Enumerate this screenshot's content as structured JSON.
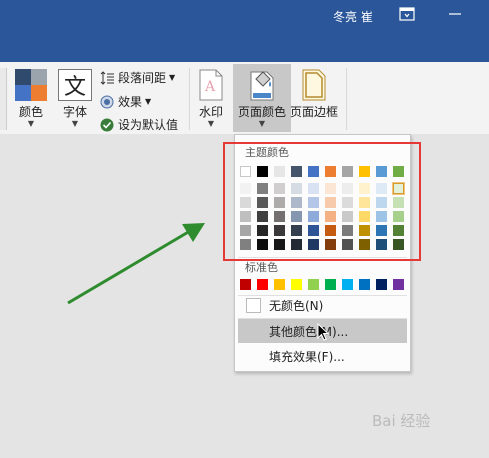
{
  "titlebar": {
    "user": "冬亮 崔",
    "ribbon_display_icon": "ribbon-display-options-icon",
    "minimize_icon": "minimize-icon",
    "bg": "#2b579a"
  },
  "ribbon": {
    "color_label": "颜色",
    "font_label": "字体",
    "font_glyph": "文",
    "paragraph_spacing": "段落间距",
    "effects": "效果",
    "set_default": "设为默认值",
    "watermark_label": "水印",
    "page_color_label": "页面颜色",
    "page_border_label": "页面边框"
  },
  "dropdown": {
    "theme_title": "主题颜色",
    "standard_title": "标准色",
    "no_color": "无颜色(N)",
    "more_colors": "其他颜色(M)...",
    "fill_effects": "填充效果(F)...",
    "theme_colors": [
      [
        "#ffffff",
        "#f2f2f2",
        "#d9d9d9",
        "#bfbfbf",
        "#a6a6a6",
        "#808080"
      ],
      [
        "#000000",
        "#7f7f7f",
        "#595959",
        "#3f3f3f",
        "#262626",
        "#0d0d0d"
      ],
      [
        "#e7e6e6",
        "#d0cece",
        "#aeabab",
        "#757070",
        "#3a3838",
        "#171616"
      ],
      [
        "#44546a",
        "#d6dce4",
        "#adb9ca",
        "#8496b0",
        "#333f4f",
        "#222a35"
      ],
      [
        "#4472c4",
        "#d9e2f3",
        "#b4c6e7",
        "#8eaadb",
        "#2f5496",
        "#1f3864"
      ],
      [
        "#ed7d31",
        "#fbe5d5",
        "#f7caac",
        "#f4b183",
        "#c55a11",
        "#833c0b"
      ],
      [
        "#a5a5a5",
        "#ededed",
        "#dbdbdb",
        "#c9c9c9",
        "#7b7b7b",
        "#525252"
      ],
      [
        "#ffc000",
        "#fff2cc",
        "#fee599",
        "#ffd965",
        "#bf9000",
        "#7f6000"
      ],
      [
        "#5b9bd5",
        "#deebf6",
        "#bdd7ee",
        "#9dc3e6",
        "#2e75b5",
        "#1f4e79"
      ],
      [
        "#70ad47",
        "#e2efd9",
        "#c5e0b3",
        "#a8d08d",
        "#538135",
        "#375623"
      ]
    ],
    "standard_colors": [
      "#c00000",
      "#ff0000",
      "#ffc000",
      "#ffff00",
      "#92d050",
      "#00b050",
      "#00b0f0",
      "#0070c0",
      "#002060",
      "#7030a0"
    ]
  },
  "annotation": {
    "highlight_color": "#e53935",
    "arrow_color": "#2e8b2e"
  },
  "watermark": "Bai 经验"
}
